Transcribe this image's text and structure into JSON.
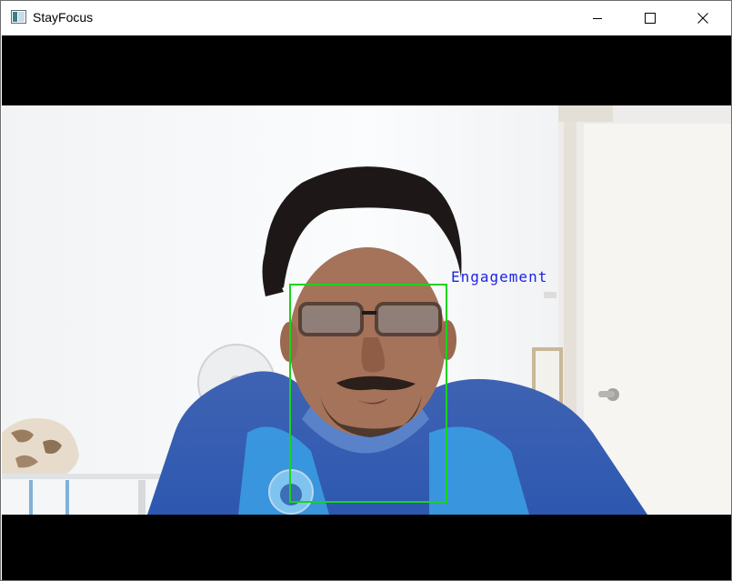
{
  "window": {
    "title": "StayFocus",
    "icon": "app-window-icon",
    "controls": {
      "minimize_icon": "minimize-icon",
      "maximize_icon": "maximize-icon",
      "close_icon": "close-icon"
    }
  },
  "video": {
    "overlay_label": "Engagement",
    "overlay_color": "#1d22e8",
    "face_box_color": "#19d419",
    "letterbox_color": "#000000"
  }
}
